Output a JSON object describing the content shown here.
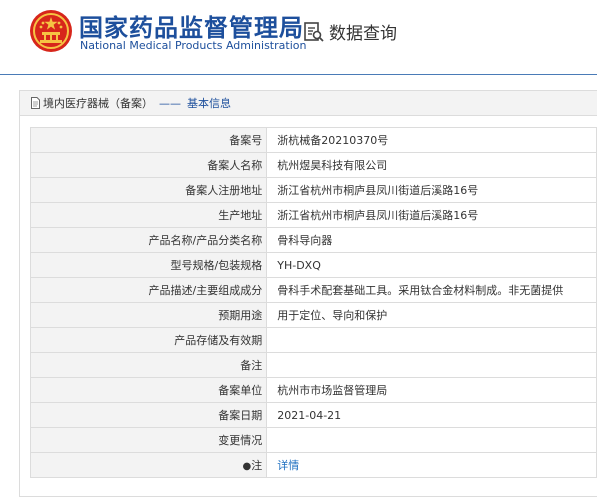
{
  "header": {
    "org_cn": "国家药品监督管理局",
    "org_en": "National Medical Products Administration",
    "query_label": "数据查询"
  },
  "breadcrumb": {
    "section": "境内医疗器械（备案）",
    "separator": "——",
    "current": "基本信息"
  },
  "rows": [
    {
      "label": "备案号",
      "value": "浙杭械备20210370号"
    },
    {
      "label": "备案人名称",
      "value": "杭州煜昊科技有限公司"
    },
    {
      "label": "备案人注册地址",
      "value": "浙江省杭州市桐庐县凤川街道后溪路16号"
    },
    {
      "label": "生产地址",
      "value": "浙江省杭州市桐庐县凤川街道后溪路16号"
    },
    {
      "label": "产品名称/产品分类名称",
      "value": "骨科导向器"
    },
    {
      "label": "型号规格/包装规格",
      "value": "YH-DXQ"
    },
    {
      "label": "产品描述/主要组成成分",
      "value": "骨科手术配套基础工具。采用钛合金材料制成。非无菌提供"
    },
    {
      "label": "预期用途",
      "value": "用于定位、导向和保护"
    },
    {
      "label": "产品存储及有效期",
      "value": ""
    },
    {
      "label": "备注",
      "value": ""
    },
    {
      "label": "备案单位",
      "value": "杭州市市场监督管理局"
    },
    {
      "label": "备案日期",
      "value": "2021-04-21"
    },
    {
      "label": "变更情况",
      "value": ""
    }
  ],
  "note": {
    "label": "注",
    "link": "详情"
  },
  "colors": {
    "brand": "#1d4f9c",
    "emblem_red": "#d7261b",
    "emblem_gold": "#f6c343",
    "link": "#1d6fc0"
  }
}
